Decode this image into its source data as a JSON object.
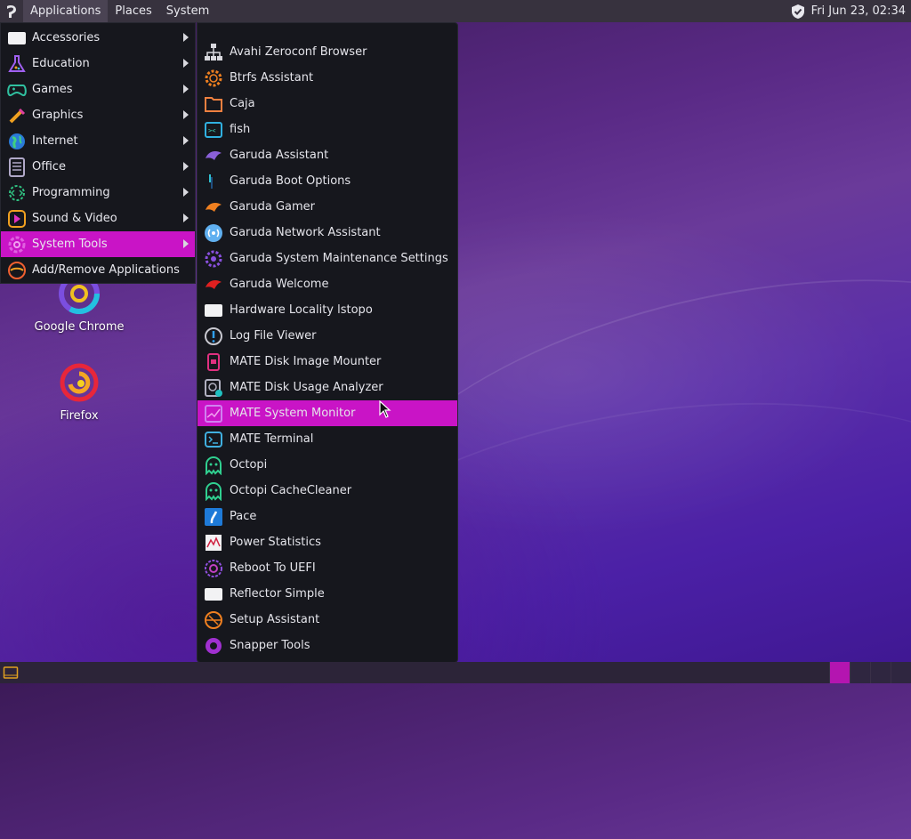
{
  "top_panel": {
    "menus": [
      "Applications",
      "Places",
      "System"
    ],
    "clock": "Fri Jun 23, 02:34"
  },
  "categories": [
    {
      "label": "Accessories",
      "icon": "accessories-icon"
    },
    {
      "label": "Education",
      "icon": "flask-icon"
    },
    {
      "label": "Games",
      "icon": "gamepad-icon"
    },
    {
      "label": "Graphics",
      "icon": "brush-icon"
    },
    {
      "label": "Internet",
      "icon": "globe-icon"
    },
    {
      "label": "Office",
      "icon": "document-icon"
    },
    {
      "label": "Programming",
      "icon": "code-gear-icon"
    },
    {
      "label": "Sound & Video",
      "icon": "play-icon"
    },
    {
      "label": "System Tools",
      "icon": "system-gear-icon",
      "selected": true
    },
    {
      "label": "Add/Remove Applications",
      "icon": "garuda-icon"
    }
  ],
  "system_tools": [
    {
      "label": "Avahi Zeroconf Browser",
      "icon": "network-icon"
    },
    {
      "label": "Btrfs Assistant",
      "icon": "btrfs-gear-icon"
    },
    {
      "label": "Caja",
      "icon": "folder-icon"
    },
    {
      "label": "fish",
      "icon": "fish-terminal-icon"
    },
    {
      "label": "Garuda Assistant",
      "icon": "garuda-bird-icon"
    },
    {
      "label": "Garuda Boot Options",
      "icon": "boot-icon"
    },
    {
      "label": "Garuda Gamer",
      "icon": "garuda-bird-icon"
    },
    {
      "label": "Garuda Network Assistant",
      "icon": "wifi-icon"
    },
    {
      "label": "Garuda System Maintenance Settings",
      "icon": "maintenance-gear-icon"
    },
    {
      "label": "Garuda Welcome",
      "icon": "garuda-bird-icon"
    },
    {
      "label": "Hardware Locality lstopo",
      "icon": "generic-app-icon"
    },
    {
      "label": "Log File Viewer",
      "icon": "warning-icon"
    },
    {
      "label": "MATE Disk Image Mounter",
      "icon": "disk-mounter-icon"
    },
    {
      "label": "MATE Disk Usage Analyzer",
      "icon": "disk-usage-icon"
    },
    {
      "label": "MATE System Monitor",
      "icon": "system-monitor-icon",
      "selected": true
    },
    {
      "label": "MATE Terminal",
      "icon": "terminal-icon"
    },
    {
      "label": "Octopi",
      "icon": "ghost-icon"
    },
    {
      "label": "Octopi CacheCleaner",
      "icon": "ghost-icon"
    },
    {
      "label": "Pace",
      "icon": "pace-icon"
    },
    {
      "label": "Power Statistics",
      "icon": "chart-icon"
    },
    {
      "label": "Reboot To UEFI",
      "icon": "uefi-icon"
    },
    {
      "label": "Reflector Simple",
      "icon": "generic-app-icon"
    },
    {
      "label": "Setup Assistant",
      "icon": "setup-icon"
    },
    {
      "label": "Snapper Tools",
      "icon": "snapper-icon"
    }
  ],
  "desktop_icons": [
    {
      "label": "Google Chrome",
      "icon": "chrome-icon"
    },
    {
      "label": "Firefox",
      "icon": "firefox-icon"
    }
  ],
  "colors": {
    "accent": "#c914c6",
    "panel": "#37323e",
    "menu_bg": "#16171d"
  }
}
